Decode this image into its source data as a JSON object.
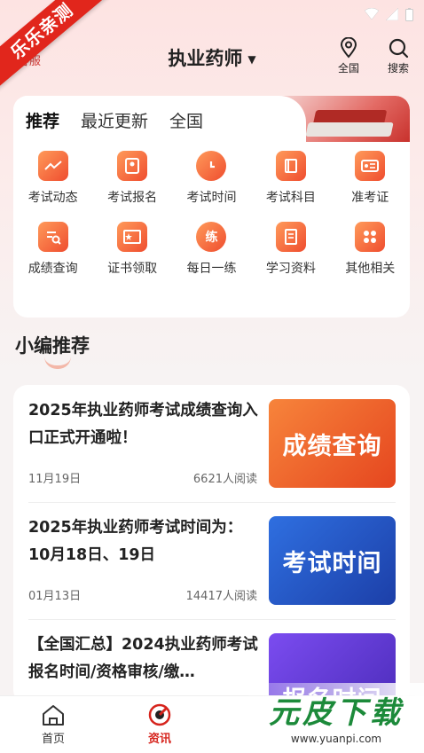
{
  "ribbon": "乐乐亲测",
  "kefu": "客服",
  "header": {
    "title": "执业药师",
    "location_label": "全国",
    "search_label": "搜索"
  },
  "tabs": [
    "推荐",
    "最近更新",
    "全国"
  ],
  "grid": [
    {
      "label": "考试动态",
      "icon": "trend-icon"
    },
    {
      "label": "考试报名",
      "icon": "id-card-icon"
    },
    {
      "label": "考试时间",
      "icon": "clock-icon"
    },
    {
      "label": "考试科目",
      "icon": "book-icon"
    },
    {
      "label": "准考证",
      "icon": "ticket-icon"
    },
    {
      "label": "成绩查询",
      "icon": "score-search-icon"
    },
    {
      "label": "证书领取",
      "icon": "certificate-icon"
    },
    {
      "label": "每日一练",
      "icon": "practice-icon",
      "glyph": "练"
    },
    {
      "label": "学习资料",
      "icon": "document-icon"
    },
    {
      "label": "其他相关",
      "icon": "grid-apps-icon"
    }
  ],
  "section_title": "小编推荐",
  "articles": [
    {
      "title": "2025年执业药师考试成绩查询入口正式开通啦！",
      "date": "11月19日",
      "reads": "6621人阅读",
      "thumb_text": "成绩查询",
      "thumb_color": "#f0662e"
    },
    {
      "title": "2025年执业药师考试时间为：10月18日、19日",
      "date": "01月13日",
      "reads": "14417人阅读",
      "thumb_text": "考试时间",
      "thumb_color": "#2456c8"
    },
    {
      "title": "【全国汇总】2024执业药师考试报名时间/资格审核/缴…",
      "date": "",
      "reads": "",
      "thumb_text": "报名时间",
      "thumb_color": "#6a3fd8"
    }
  ],
  "bottom_nav": [
    {
      "label": "首页",
      "icon": "home-icon"
    },
    {
      "label": "资讯",
      "icon": "news-icon"
    }
  ],
  "watermark": {
    "main": "元皮下载",
    "url": "www.yuanpi.com"
  },
  "colors": {
    "accent": "#d6231c",
    "orange": "#ef4d2f"
  }
}
